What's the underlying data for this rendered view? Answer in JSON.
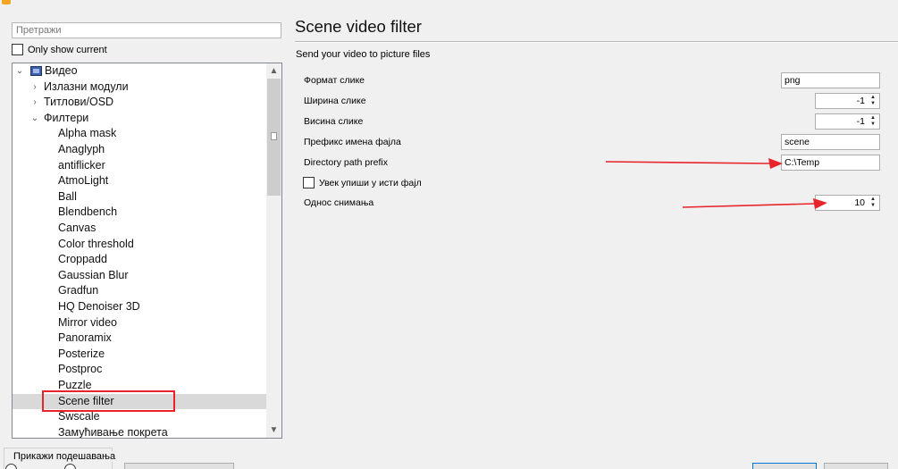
{
  "sidebar": {
    "search_placeholder": "Претражи",
    "only_show_current": "Only show current",
    "tree": [
      {
        "label": "Видео",
        "level": 0,
        "arrow": "⌄",
        "icon": "video-icon"
      },
      {
        "label": "Излазни модули",
        "level": 1,
        "arrow": "›"
      },
      {
        "label": "Титлови/OSD",
        "level": 1,
        "arrow": "›"
      },
      {
        "label": "Филтери",
        "level": 1,
        "arrow": "⌄"
      },
      {
        "label": "Alpha mask",
        "level": 2
      },
      {
        "label": "Anaglyph",
        "level": 2
      },
      {
        "label": "antiflicker",
        "level": 2
      },
      {
        "label": "AtmoLight",
        "level": 2
      },
      {
        "label": "Ball",
        "level": 2
      },
      {
        "label": "Blendbench",
        "level": 2
      },
      {
        "label": "Canvas",
        "level": 2
      },
      {
        "label": "Color threshold",
        "level": 2
      },
      {
        "label": "Croppadd",
        "level": 2
      },
      {
        "label": "Gaussian Blur",
        "level": 2
      },
      {
        "label": "Gradfun",
        "level": 2
      },
      {
        "label": "HQ Denoiser 3D",
        "level": 2
      },
      {
        "label": "Mirror video",
        "level": 2
      },
      {
        "label": "Panoramix",
        "level": 2
      },
      {
        "label": "Posterize",
        "level": 2
      },
      {
        "label": "Postproc",
        "level": 2
      },
      {
        "label": "Puzzle",
        "level": 2
      },
      {
        "label": "Scene filter",
        "level": 2,
        "selected": true
      },
      {
        "label": "Swscale",
        "level": 2
      },
      {
        "label": "Замућивање покрета",
        "level": 2
      }
    ],
    "show_settings_label": "Прикажи подешавања"
  },
  "panel": {
    "title": "Scene video filter",
    "subtitle": "Send your video to picture files",
    "fields": {
      "image_format": {
        "label": "Формат слике",
        "value": "png"
      },
      "image_width": {
        "label": "Ширина слике",
        "value": "-1"
      },
      "image_height": {
        "label": "Висина слике",
        "value": "-1"
      },
      "filename_prefix": {
        "label": "Префикс имена фајла",
        "value": "scene"
      },
      "directory_path_prefix": {
        "label": "Directory path prefix",
        "value": "C:\\Temp"
      },
      "always_write_same_file": {
        "label": "Увек упиши у исти фајл",
        "checked": false
      },
      "recording_ratio": {
        "label": "Однос снимања",
        "value": "10"
      }
    }
  },
  "annotation_color": "#e8232a"
}
